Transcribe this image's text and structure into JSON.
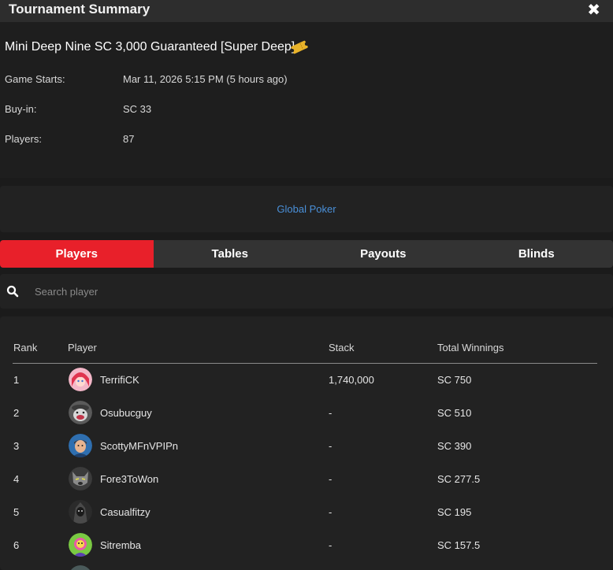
{
  "window": {
    "title": "Tournament Summary",
    "close_label": "✖"
  },
  "tournament": {
    "name": "Mini Deep Nine SC 3,000 Guaranteed [Super Deep]",
    "ticket_icon": "ticket-icon",
    "details": [
      {
        "label": "Game Starts:",
        "value": "Mar 11, 2026 5:15 PM (5 hours ago)"
      },
      {
        "label": "Buy-in:",
        "value": "SC 33"
      },
      {
        "label": "Players:",
        "value": "87"
      }
    ]
  },
  "brand": {
    "link_text": "Global Poker",
    "color": "#4a90d9"
  },
  "tabs": [
    {
      "label": "Players",
      "active": true
    },
    {
      "label": "Tables",
      "active": false
    },
    {
      "label": "Payouts",
      "active": false
    },
    {
      "label": "Blinds",
      "active": false
    }
  ],
  "search": {
    "placeholder": "Search player",
    "value": ""
  },
  "table": {
    "headers": {
      "rank": "Rank",
      "player": "Player",
      "stack": "Stack",
      "winnings": "Total Winnings"
    },
    "rows": [
      {
        "rank": "1",
        "player": "TerrifiCK",
        "stack": "1,740,000",
        "winnings": "SC 750"
      },
      {
        "rank": "2",
        "player": "Osubucguy",
        "stack": "-",
        "winnings": "SC 510"
      },
      {
        "rank": "3",
        "player": "ScottyMFnVPIPn",
        "stack": "-",
        "winnings": "SC 390"
      },
      {
        "rank": "4",
        "player": "Fore3ToWon",
        "stack": "-",
        "winnings": "SC 277.5"
      },
      {
        "rank": "5",
        "player": "Casualfitzy",
        "stack": "-",
        "winnings": "SC 195"
      },
      {
        "rank": "6",
        "player": "Sitremba",
        "stack": "-",
        "winnings": "SC 157.5"
      }
    ]
  },
  "colors": {
    "accent": "#e8202a",
    "background": "#1b1b1b"
  }
}
